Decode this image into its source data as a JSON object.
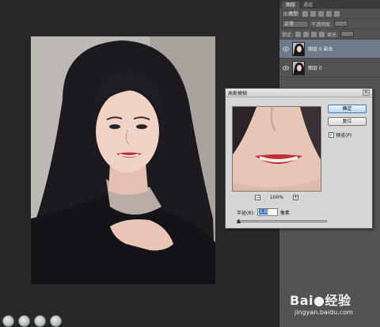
{
  "panel": {
    "tabs": [
      "图层",
      "通道"
    ],
    "kind_label": "类型",
    "blend_mode": "正常",
    "opacity_label": "不透明度:",
    "opacity_value": "100%",
    "lock_label": "锁定:",
    "fill_label": "填充:",
    "fill_value": "100%",
    "layers": [
      {
        "name": "图层 0 副本",
        "selected": true
      },
      {
        "name": "图层 0",
        "selected": false
      }
    ]
  },
  "dialog": {
    "title": "高斯模糊",
    "close": "×",
    "ok_label": "确定",
    "reset_label": "复位",
    "preview_label": "预览(P)",
    "preview_checked": "✓",
    "zoom_out": "−",
    "zoom_value": "100%",
    "zoom_in": "+",
    "radius_label": "半径(R):",
    "radius_value": "1.0",
    "radius_unit": "像素"
  },
  "watermark": {
    "brand": "Bai",
    "brand_cn": "经验",
    "url": "jingyan.baidu.com"
  },
  "colors": {
    "workspace": "#282828",
    "panel": "#535353",
    "dialog": "#d6d6d6",
    "selected_layer": "#6e7a8a",
    "accent": "#3b7cc7"
  },
  "icons": [
    "eye-icon",
    "close-icon",
    "checkbox-icon",
    "zoom-out-icon",
    "zoom-in-icon",
    "slider-knob-icon",
    "paw-icon",
    "search-icon",
    "adjust-icon",
    "text-icon",
    "lock-icon"
  ]
}
